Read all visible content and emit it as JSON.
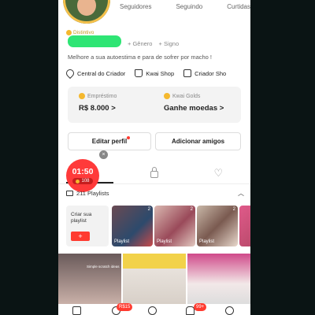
{
  "profile": {
    "stats": [
      "Seguidores",
      "Seguindo",
      "Curtidas"
    ],
    "badge_label": "Distintivo",
    "tags": [
      "+ Gênero",
      "+ Signo"
    ],
    "bio": "Melhore a sua autoestima e para de sofrer por macho !"
  },
  "quick_links": [
    "Central do Criador",
    "Kwai Shop",
    "Criador Sho"
  ],
  "finance_card": {
    "loan_label": "Empréstimo",
    "loan_value": "R$ 8.000 >",
    "golds_label": "Kwai Golds",
    "golds_value": "Ganhe moedas >"
  },
  "buttons": {
    "edit_profile": "Editar perfil",
    "add_friends": "Adicionar amigos"
  },
  "timer": {
    "time": "01:50",
    "points": "108"
  },
  "playlists": {
    "count_label": "211 Playlists",
    "create_label": "Criar sua playlist",
    "create_plus": "+",
    "thumbs": [
      {
        "label": "Playlist",
        "count": "2"
      },
      {
        "label": "Playlist",
        "count": "2"
      },
      {
        "label": "Playlist",
        "count": "2"
      }
    ]
  },
  "video_grid": {
    "first_caption": "Simple scratch ideas"
  },
  "nav": {
    "badge_shop": "R$15",
    "badge_inbox": "99+"
  },
  "colors": {
    "accent": "#ff3b30",
    "gold": "#f5b82e",
    "name_highlight": "#2ee574"
  }
}
